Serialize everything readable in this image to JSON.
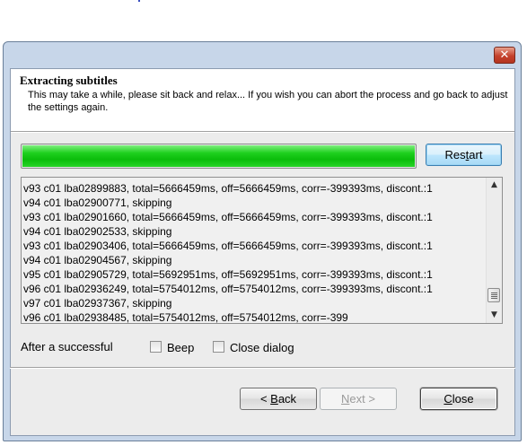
{
  "window": {
    "close_glyph": "✕"
  },
  "header": {
    "title": "Extracting subtitles",
    "subtitle": "This may take a while, please sit back and relax... If you wish you can abort the process and go back to adjust the settings again."
  },
  "progress": {
    "percent": 100,
    "color": "#1fd01f"
  },
  "restart_button": {
    "label_pre": "Res",
    "label_ul": "t",
    "label_post": "art"
  },
  "log": {
    "lines": [
      "v93 c01 lba02899883, total=5666459ms, off=5666459ms, corr=-399393ms, discont.:1",
      "v94 c01 lba02900771, skipping",
      "v93 c01 lba02901660, total=5666459ms, off=5666459ms, corr=-399393ms, discont.:1",
      "v94 c01 lba02902533, skipping",
      "v93 c01 lba02903406, total=5666459ms, off=5666459ms, corr=-399393ms, discont.:1",
      "v94 c01 lba02904567, skipping",
      "v95 c01 lba02905729, total=5692951ms, off=5692951ms, corr=-399393ms, discont.:1",
      "v96 c01 lba02936249, total=5754012ms, off=5754012ms, corr=-399393ms, discont.:1",
      "v97 c01 lba02937367, skipping",
      "v96 c01 lba02938485, total=5754012ms, off=5754012ms, corr=-399"
    ],
    "scroll_up": "▲",
    "scroll_down": "▼"
  },
  "options": {
    "label": "After a successful",
    "beep": {
      "label": "Beep",
      "checked": false
    },
    "close_dialog": {
      "label": "Close dialog",
      "checked": false
    }
  },
  "footer": {
    "back": {
      "prefix": "< ",
      "ul": "B",
      "rest": "ack"
    },
    "next": {
      "ul": "N",
      "rest": "ext >"
    },
    "close": {
      "ul": "C",
      "rest": "lose"
    }
  }
}
